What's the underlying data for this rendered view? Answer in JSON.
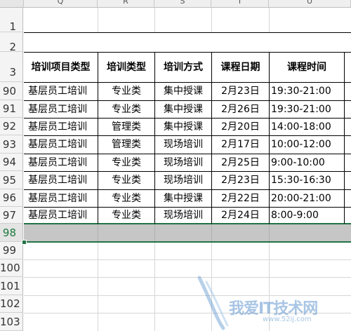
{
  "sheet": {
    "column_headers": [
      "Q",
      "R",
      "S",
      "T",
      "U"
    ],
    "header_row_labels": [
      "1",
      "2",
      "3"
    ],
    "table_headers": [
      "培训项目类型",
      "培训类型",
      "培训方式",
      "课程日期",
      "课程时间"
    ],
    "rows": [
      {
        "row": "90",
        "project": "基层员工培训",
        "type": "专业类",
        "method": "集中授课",
        "date": "2月23日",
        "time": "19:30-21:00"
      },
      {
        "row": "91",
        "project": "基层员工培训",
        "type": "专业类",
        "method": "集中授课",
        "date": "2月26日",
        "time": "19:30-21:00"
      },
      {
        "row": "92",
        "project": "基层员工培训",
        "type": "管理类",
        "method": "集中授课",
        "date": "2月20日",
        "time": "14:00-18:00"
      },
      {
        "row": "93",
        "project": "基层员工培训",
        "type": "管理类",
        "method": "现场培训",
        "date": "2月17日",
        "time": "10:00-12:00"
      },
      {
        "row": "94",
        "project": "基层员工培训",
        "type": "专业类",
        "method": "现场培训",
        "date": "2月25日",
        "time": "9:00-10:00"
      },
      {
        "row": "95",
        "project": "基层员工培训",
        "type": "专业类",
        "method": "现场培训",
        "date": "2月23日",
        "time": "15:30-16:30"
      },
      {
        "row": "96",
        "project": "基层员工培训",
        "type": "专业类",
        "method": "集中授课",
        "date": "2月22日",
        "time": "20:00-21:00"
      },
      {
        "row": "97",
        "project": "基层员工培训",
        "type": "专业类",
        "method": "现场培训",
        "date": "2月24日",
        "time": "8:00-9:00"
      }
    ],
    "empty_row_labels": [
      "98",
      "99",
      "100",
      "101",
      "102",
      "103"
    ],
    "selected_row": "98"
  },
  "watermark": {
    "text": "我爱IT技术网",
    "url": "www.52ij.com"
  },
  "colors": {
    "selection_green": "#217346",
    "selected_row_fill": "#c6c6c6",
    "watermark_blue": "#6096ce"
  }
}
